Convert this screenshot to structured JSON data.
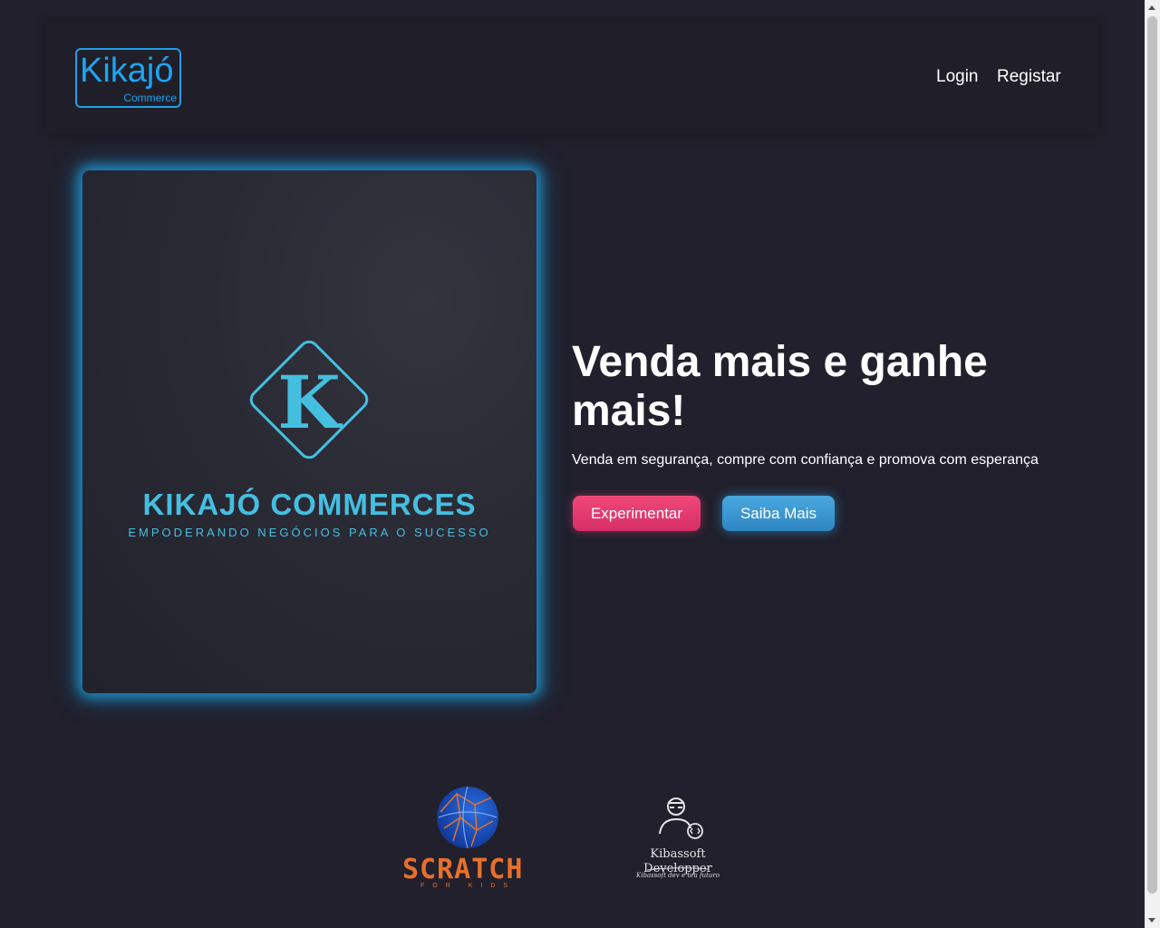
{
  "header": {
    "logo_main": "Kikajó",
    "logo_sub": "Commerce",
    "nav": {
      "login": "Login",
      "register": "Registar"
    }
  },
  "hero": {
    "brand_letter": "K",
    "brand_title": "KIKAJÓ COMMERCES",
    "brand_tagline": "EMPODERANDO NEGÓCIOS PARA O SUCESSO",
    "headline": "Venda mais e ganhe mais!",
    "subline": "Venda em segurança, compre com confiança e promova com esperança",
    "buttons": {
      "try": "Experimentar",
      "more": "Saiba Mais"
    }
  },
  "partners": {
    "scratch": {
      "title": "SCRATCH",
      "sub": "FOR KIDS"
    },
    "kibassoft": {
      "name": "Kibassoft Developper",
      "tagline": "Kibassoft dev e teu futuro"
    }
  },
  "colors": {
    "background": "#21202c",
    "accent_blue": "#1ea4ef",
    "brand_teal": "#45bfe0",
    "button_pink": "#e23a6f",
    "button_blue": "#3a98d2",
    "scratch_orange": "#e8702a"
  }
}
